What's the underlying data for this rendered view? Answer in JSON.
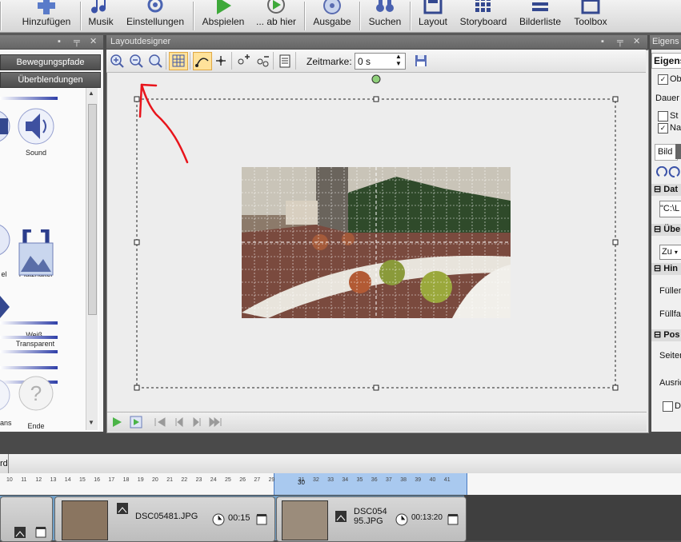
{
  "toolbar": {
    "items": [
      {
        "label": "Hinzufügen",
        "icon": "plus-icon"
      },
      {
        "label": "Musik",
        "icon": "music-note-icon"
      },
      {
        "label": "Einstellungen",
        "icon": "settings-icon"
      },
      {
        "label": "Abspielen",
        "icon": "play-icon"
      },
      {
        "label": "... ab hier",
        "icon": "play-from-here-icon"
      },
      {
        "label": "Ausgabe",
        "icon": "output-disc-icon"
      },
      {
        "label": "Suchen",
        "icon": "binoculars-icon"
      },
      {
        "label": "Layout",
        "icon": "layout-icon"
      },
      {
        "label": "Storyboard",
        "icon": "storyboard-grid-icon"
      },
      {
        "label": "Bilderliste",
        "icon": "image-list-icon"
      },
      {
        "label": "Toolbox",
        "icon": "toolbox-icon"
      }
    ]
  },
  "left_panel": {
    "buttons": [
      "Bewegungspfade",
      "Überblendungen"
    ],
    "items": [
      {
        "label": "Sound",
        "icon": "speaker-icon"
      },
      {
        "label": "Platzhalter",
        "icon": "brackets-icon"
      },
      {
        "label": "Weiß,\nTransparent",
        "icon": "mountain-image-icon"
      },
      {
        "label": "Ende",
        "icon": "question-mark-icon"
      }
    ],
    "partial_labels": [
      "el",
      "ans"
    ]
  },
  "designer": {
    "title": "Layoutdesigner",
    "zeitmarke_label": "Zeitmarke:",
    "zeitmarke_value": "0 s"
  },
  "right_panel": {
    "title": "Eigens",
    "tab": "Eigens",
    "check_ob": "Ob",
    "dauer": "Dauer",
    "check_st": "St",
    "check_na": "Na",
    "bild_tab": "Bild",
    "sec_dat": "Dat",
    "path_value": "\"C:\\L",
    "sec_ueb": "Übe",
    "select_value": "Zu",
    "sec_hin": "Hin",
    "fuellen": "Füllen",
    "fuellfa": "Füllfa",
    "sec_pos": "Pos",
    "seite": "Seiten",
    "ausri": "Ausric",
    "check_dr": "Dr"
  },
  "timeline": {
    "header": "rd",
    "ruler_ticks": [
      "10",
      "11",
      "12",
      "13",
      "14",
      "15",
      "16",
      "17",
      "18",
      "19",
      "20",
      "21",
      "22",
      "23",
      "24",
      "25",
      "26",
      "27",
      "29",
      "30",
      "31",
      "32",
      "33",
      "34",
      "35",
      "36",
      "37",
      "38",
      "39",
      "40",
      "41"
    ],
    "selected_tick": "30"
  },
  "storyboard": {
    "clip1_name": "DSC05481.JPG",
    "clip1_duration": "00:15",
    "clip2_name": "DSC054\n95.JPG",
    "clip2_duration": "00:13:20"
  },
  "colors": {
    "annotation": "#e8141b",
    "selection": "#a8c8f0",
    "accent": "#2f3fa8"
  }
}
